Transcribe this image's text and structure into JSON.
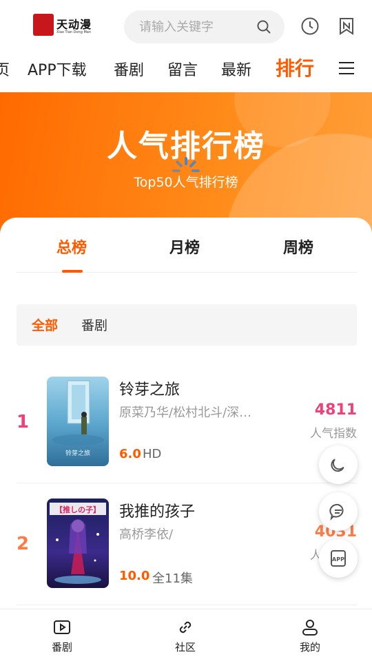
{
  "header": {
    "logo_text": "天动漫",
    "logo_sub": "Xiao Tian Dong Man",
    "search_placeholder": "请输入关键字"
  },
  "nav": {
    "items": [
      "页",
      "APP下载",
      "番剧",
      "留言",
      "最新",
      "排行"
    ],
    "active": "排行"
  },
  "banner": {
    "title": "人气排行榜",
    "subtitle": "Top50人气排行榜"
  },
  "tabs": [
    "总榜",
    "月榜",
    "周榜"
  ],
  "filters": [
    "全部",
    "番剧"
  ],
  "list": [
    {
      "rank": "1",
      "name": "铃芽之旅",
      "cast": "原菜乃华/松村北斗/深…",
      "score": "6.0",
      "episodes": "HD",
      "hot": "4811",
      "hot_label": "人气指数",
      "poster_text": "铃芽之旅"
    },
    {
      "rank": "2",
      "name": "我推的孩子",
      "cast": "高桥李依/",
      "score": "10.0",
      "episodes": "全11集",
      "hot": "4031",
      "hot_label": "人气指数",
      "poster_text": "【推しの子】"
    }
  ],
  "fabs": [
    "moon-icon",
    "chat-icon",
    "app-icon"
  ],
  "fab_app_label": "APP",
  "tabbar": [
    "番剧",
    "社区",
    "我的"
  ],
  "colors": {
    "accent": "#ff5a00",
    "rank1": "#f04078",
    "rank2": "#ff7a45",
    "hot": "#f04078"
  }
}
